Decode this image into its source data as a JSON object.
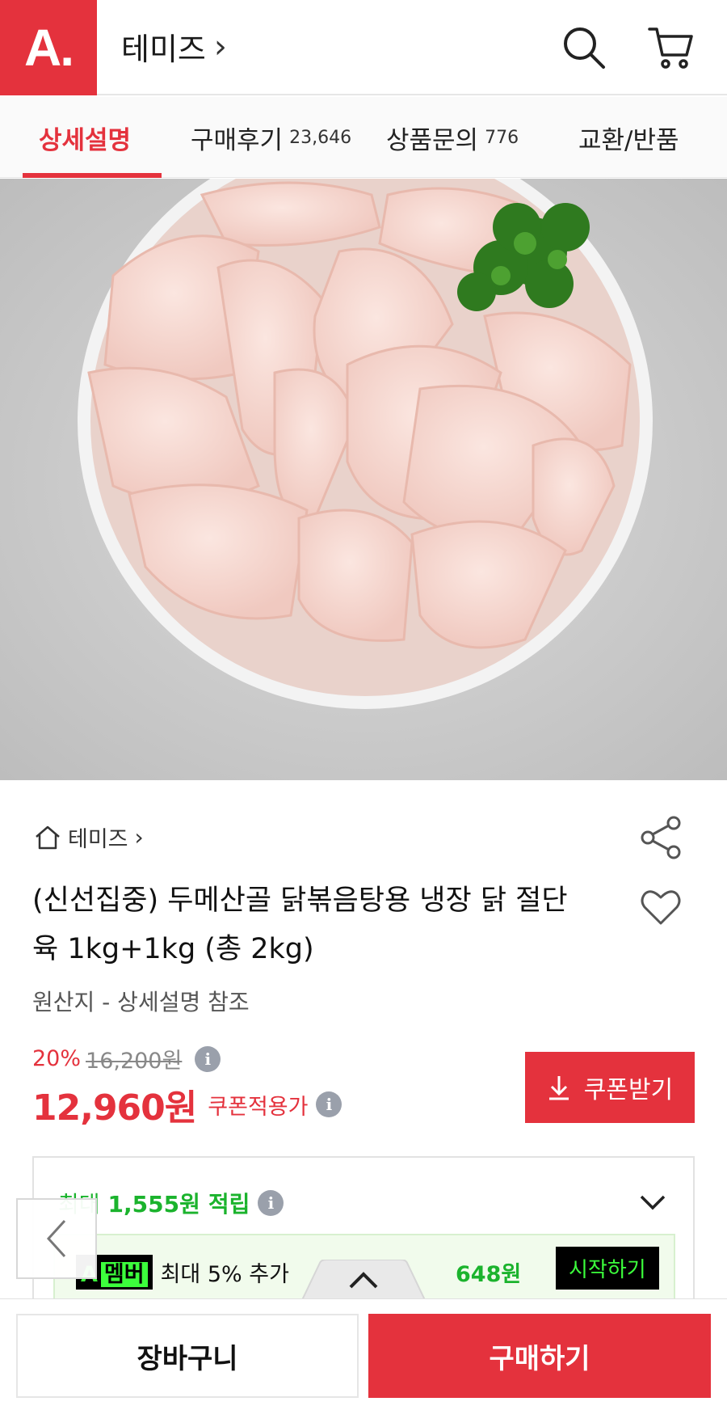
{
  "header": {
    "logo_text": "A.",
    "store_name": "테미즈",
    "store_chevron": "›",
    "search_icon": "search-icon",
    "cart_icon": "cart-icon"
  },
  "tabs": [
    {
      "label": "상세설명",
      "count": "",
      "active": true
    },
    {
      "label": "구매후기",
      "count": "23,646",
      "active": false
    },
    {
      "label": "상품문의",
      "count": "776",
      "active": false
    },
    {
      "label": "교환/반품",
      "count": "",
      "active": false
    }
  ],
  "product": {
    "breadcrumb": "테미즈",
    "title": "(신선집중) 두메산골 닭볶음탕용 냉장 닭 절단육 1kg+1kg (총 2kg)",
    "origin": "원산지 - 상세설명 참조",
    "discount_rate": "20%",
    "original_price": "16,200원",
    "price": "12,960원",
    "price_label": "쿠폰적용가",
    "coupon_button": "쿠폰받기"
  },
  "reward": {
    "prefix": "최대",
    "amount": "1,555원",
    "suffix": "적립",
    "member_badge_prefix": "A",
    "member_badge": "멤버",
    "member_text": "최대 5% 추가",
    "member_amount": "648원",
    "start_button": "시작하기"
  },
  "bottom": {
    "cart_button": "장바구니",
    "buy_button": "구매하기"
  },
  "colors": {
    "brand": "#e4323d",
    "reward_green": "#1bb32d",
    "member_green": "#3cff3c"
  }
}
